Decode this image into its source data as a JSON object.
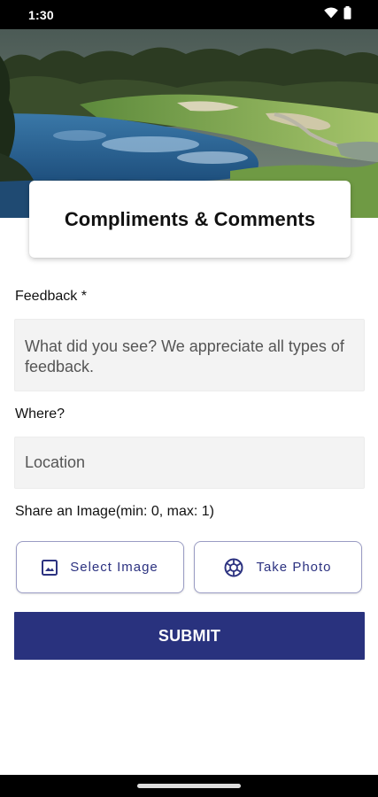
{
  "status_bar": {
    "time": "1:30"
  },
  "header": {
    "title": "Compliments & Comments"
  },
  "form": {
    "feedback_label": "Feedback *",
    "feedback_placeholder": "What did you see? We appreciate all types of feedback.",
    "where_label": "Where?",
    "location_placeholder": "Location",
    "image_label": "Share an Image(min: 0, max: 1)",
    "select_image_label": "Select Image",
    "take_photo_label": "Take Photo",
    "submit_label": "SUBMIT"
  },
  "icons": {
    "wifi": "wifi-icon",
    "battery": "battery-icon",
    "select_image": "image-icon",
    "take_photo": "camera-shutter-icon"
  },
  "colors": {
    "accent": "#29327e",
    "button_border": "#9a9cc4",
    "field_bg": "#f3f3f3"
  }
}
